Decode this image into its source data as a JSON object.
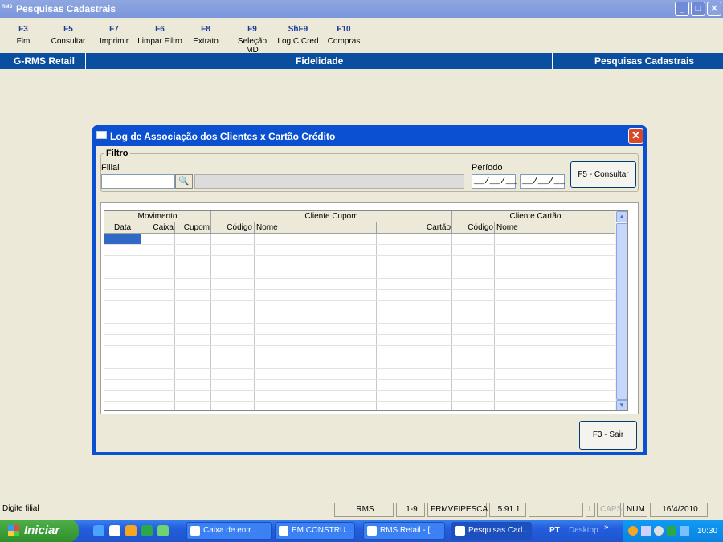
{
  "window": {
    "app_icon": "RMS",
    "title": "Pesquisas Cadastrais",
    "min": "_",
    "max": "□",
    "close": "✕"
  },
  "fkeys": [
    {
      "key": "F3",
      "label": "Fim"
    },
    {
      "key": "F5",
      "label": "Consultar"
    },
    {
      "key": "F7",
      "label": "Imprimir"
    },
    {
      "key": "F6",
      "label": "Limpar Filtro"
    },
    {
      "key": "F8",
      "label": "Extrato"
    },
    {
      "key": "F9",
      "label": "Seleção MD"
    },
    {
      "key": "ShF9",
      "label": "Log C.Cred"
    },
    {
      "key": "F10",
      "label": "Compras"
    }
  ],
  "module_bar": {
    "left": "G-RMS Retail",
    "center": "Fidelidade",
    "right": "Pesquisas Cadastrais"
  },
  "dialog": {
    "title": "Log de Associação dos Clientes x Cartão Crédito",
    "close": "✕",
    "filter": {
      "legend": "Filtro",
      "filial_label": "Filial",
      "filial_value": "",
      "periodo_label": "Período",
      "periodo_from": "__/__/__",
      "periodo_to": "__/__/__",
      "consult_button": "F5 - Consultar"
    },
    "grid": {
      "groups": [
        "Movimento",
        "Cliente Cupom",
        "Cliente Cartão"
      ],
      "columns": [
        "Data",
        "Caixa",
        "Cupom",
        "Código",
        "Nome",
        "Cartão",
        "Código",
        "Nome"
      ]
    },
    "exit_button": "F3 - Sair"
  },
  "statusbar": {
    "message": "Digite filial",
    "sys": "RMS",
    "range": "1-9",
    "form": "FRMVFIPESCA",
    "version": "5.91.1",
    "l": "L",
    "caps": "CAPS",
    "num": "NUM",
    "date": "16/4/2010"
  },
  "taskbar": {
    "start": "Iniciar",
    "tasks": [
      "Caixa de entr...",
      "EM CONSTRU...",
      "RMS Retail - [...",
      "Pesquisas Cad..."
    ],
    "lang": "PT",
    "desktop": "Desktop",
    "chevron": "»",
    "clock": "10:30"
  }
}
